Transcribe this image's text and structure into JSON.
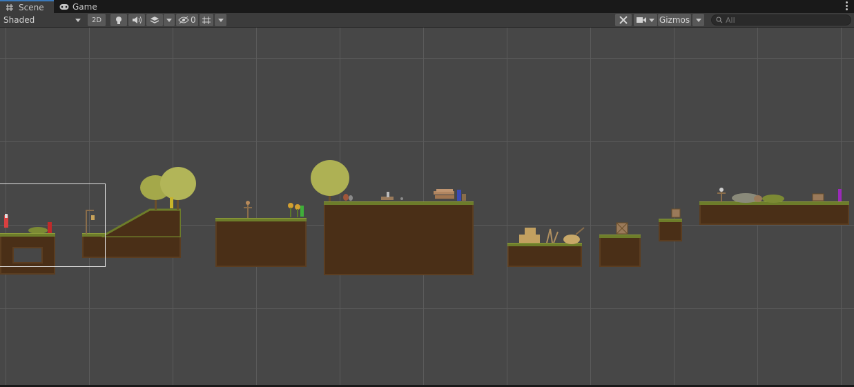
{
  "tabs": [
    {
      "label": "Scene",
      "icon": "grid-icon",
      "active": true
    },
    {
      "label": "Game",
      "icon": "gamepad-icon",
      "active": false
    }
  ],
  "toolbar": {
    "shading_mode": "Shaded",
    "mode_2d_label": "2D",
    "hidden_count": "0",
    "gizmos_label": "Gizmos",
    "search_placeholder": "All"
  },
  "colors": {
    "accent": "#3a79bb",
    "scene_bg": "#474747",
    "grid": "#5b5b5b",
    "dirt": "#4a2f17",
    "grass": "#6d7d2a"
  }
}
